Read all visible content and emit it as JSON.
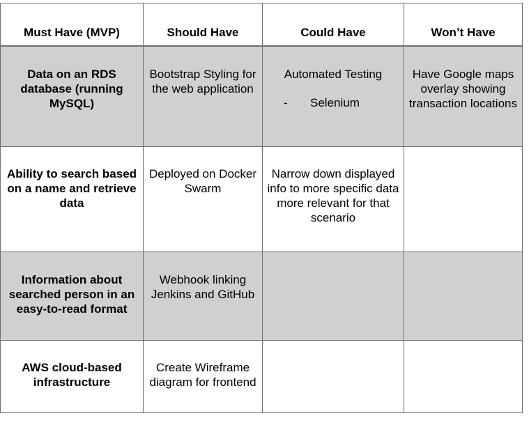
{
  "headers": [
    "Must Have (MVP)",
    "Should Have",
    "Could Have",
    "Won’t Have"
  ],
  "rows": [
    {
      "must": "Data on an RDS database (running MySQL)",
      "should": "Bootstrap Styling for the web application",
      "could": "Automated Testing",
      "could_bullet": "Selenium",
      "bullet_marker": "-",
      "wont": "Have Google maps overlay showing transaction locations"
    },
    {
      "must": "Ability to search based on a name and retrieve data",
      "should": "Deployed on Docker Swarm",
      "could": "Narrow down displayed info to more specific data more relevant for that scenario",
      "wont": ""
    },
    {
      "must": "Information about searched person in an easy-to-read format",
      "should": "Webhook linking Jenkins and GitHub",
      "could": "",
      "wont": ""
    },
    {
      "must": "AWS cloud-based infrastructure",
      "should": "Create Wireframe diagram for frontend",
      "could": "",
      "wont": ""
    }
  ],
  "colors": {
    "shaded_row": "#d0d0d0",
    "border": "#6f6f6f"
  }
}
